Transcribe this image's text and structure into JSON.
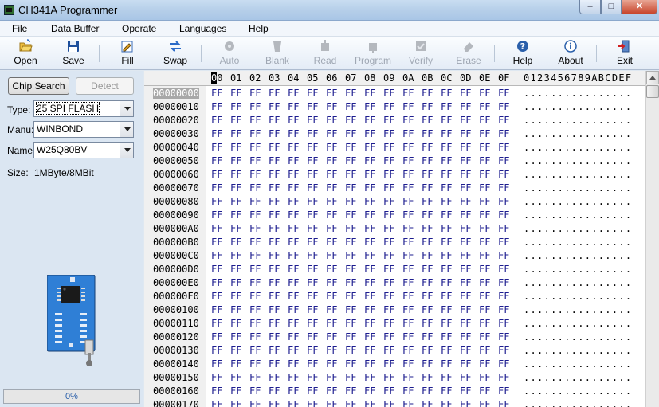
{
  "window": {
    "title": "CH341A Programmer",
    "min": "–",
    "max": "□",
    "close": "✕"
  },
  "menu": [
    "File",
    "Data Buffer",
    "Operate",
    "Languages",
    "Help"
  ],
  "toolbar": [
    {
      "label": "Open",
      "icon": "folder-open-icon",
      "enabled": true
    },
    {
      "label": "Save",
      "icon": "floppy-disk-icon",
      "enabled": true
    },
    {
      "label": "Fill",
      "icon": "fill-icon",
      "enabled": true
    },
    {
      "label": "Swap",
      "icon": "swap-arrows-icon",
      "enabled": true
    },
    {
      "label": "Auto",
      "icon": "auto-gear-icon",
      "enabled": false
    },
    {
      "label": "Blank",
      "icon": "blank-check-icon",
      "enabled": false
    },
    {
      "label": "Read",
      "icon": "read-chip-icon",
      "enabled": false
    },
    {
      "label": "Program",
      "icon": "program-chip-icon",
      "enabled": false
    },
    {
      "label": "Verify",
      "icon": "verify-icon",
      "enabled": false
    },
    {
      "label": "Erase",
      "icon": "eraser-icon",
      "enabled": false
    },
    {
      "label": "Help",
      "icon": "help-question-icon",
      "enabled": true
    },
    {
      "label": "About",
      "icon": "info-icon",
      "enabled": true
    },
    {
      "label": "Exit",
      "icon": "exit-door-icon",
      "enabled": true
    }
  ],
  "chip": {
    "chip_search_label": "Chip Search",
    "detect_label": "Detect",
    "type_label": "Type:",
    "type_value": "25 SPI FLASH",
    "manu_label": "Manu:",
    "manu_value": "WINBOND",
    "name_label": "Name:",
    "name_value": "W25Q80BV",
    "size_label": "Size:",
    "size_value": "1MByte/8MBit"
  },
  "progress": {
    "text": "0%",
    "fraction": 0
  },
  "hex": {
    "columns": [
      "00",
      "01",
      "02",
      "03",
      "04",
      "05",
      "06",
      "07",
      "08",
      "09",
      "0A",
      "0B",
      "0C",
      "0D",
      "0E",
      "0F"
    ],
    "ascii_header": "0123456789ABCDEF",
    "fill_byte": "FF",
    "ascii_fill": "................",
    "addresses": [
      "00000000",
      "00000010",
      "00000020",
      "00000030",
      "00000040",
      "00000050",
      "00000060",
      "00000070",
      "00000080",
      "00000090",
      "000000A0",
      "000000B0",
      "000000C0",
      "000000D0",
      "000000E0",
      "000000F0",
      "00000100",
      "00000110",
      "00000120",
      "00000130",
      "00000140",
      "00000150",
      "00000160",
      "00000170"
    ],
    "selected_address": "00000000"
  },
  "colors": {
    "hex_value": "#1d1d8f",
    "accent": "#2a5faa",
    "board_blue": "#2f7fd6"
  }
}
